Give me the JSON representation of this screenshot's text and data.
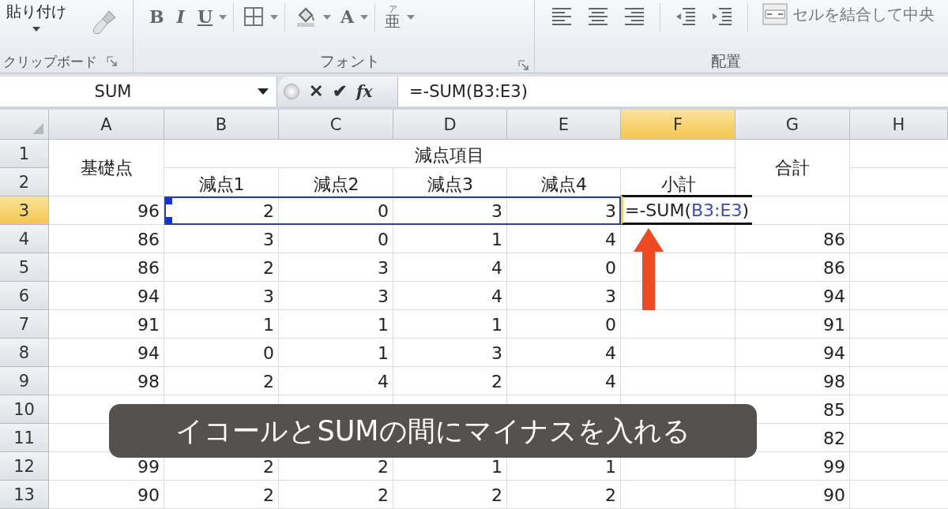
{
  "ribbon": {
    "clipboard": {
      "paste_label": "貼り付け",
      "label": "クリップボード"
    },
    "font": {
      "label": "フォント",
      "buttons": [
        {
          "kind": "bold",
          "text": "B"
        },
        {
          "kind": "italic",
          "text": "I"
        },
        {
          "kind": "underline",
          "text": "U"
        },
        {
          "kind": "borders"
        },
        {
          "kind": "fill"
        },
        {
          "kind": "font-color",
          "text": "A"
        },
        {
          "kind": "phonetic",
          "text": "亜",
          "ruby": "ア"
        }
      ]
    },
    "alignment": {
      "label": "配置",
      "merge_label": "セルを結合して中央"
    }
  },
  "formula_bar": {
    "name_box": "SUM",
    "cancel": "✕",
    "enter": "✔",
    "function": "fx",
    "formula": "=-SUM(B3:E3)"
  },
  "sheet": {
    "columns": [
      {
        "label": "A",
        "selected": false
      },
      {
        "label": "B",
        "selected": false
      },
      {
        "label": "C",
        "selected": false
      },
      {
        "label": "D",
        "selected": false
      },
      {
        "label": "E",
        "selected": false
      },
      {
        "label": "F",
        "selected": true
      },
      {
        "label": "G",
        "selected": false
      },
      {
        "label": "H",
        "selected": false
      }
    ],
    "titles": {
      "base": "基礎点",
      "group": "減点項目",
      "total": "合計"
    },
    "rows": [
      {
        "label": "1",
        "selected": false,
        "kind": "header"
      },
      {
        "label": "2",
        "selected": false,
        "kind": "header",
        "cells": {
          "B": "減点1",
          "C": "減点2",
          "D": "減点3",
          "E": "減点4",
          "F": "小計"
        }
      },
      {
        "label": "3",
        "selected": true,
        "kind": "data",
        "cells": {
          "A": "96",
          "B": "2",
          "C": "0",
          "D": "3",
          "E": "3",
          "F": {
            "parts": [
              {
                "text": "=-SUM(",
                "kind": "plain"
              },
              {
                "text": "B3:E3",
                "kind": "reference"
              },
              {
                "text": ")",
                "kind": "plain"
              }
            ]
          }
        }
      },
      {
        "label": "4",
        "selected": false,
        "kind": "data",
        "cells": {
          "A": "86",
          "B": "3",
          "C": "0",
          "D": "1",
          "E": "4",
          "G": "86"
        }
      },
      {
        "label": "5",
        "selected": false,
        "kind": "data",
        "cells": {
          "A": "86",
          "B": "2",
          "C": "3",
          "D": "4",
          "E": "0",
          "G": "86"
        }
      },
      {
        "label": "6",
        "selected": false,
        "kind": "data",
        "cells": {
          "A": "94",
          "B": "3",
          "C": "3",
          "D": "4",
          "E": "3",
          "G": "94"
        }
      },
      {
        "label": "7",
        "selected": false,
        "kind": "data",
        "cells": {
          "A": "91",
          "B": "1",
          "C": "1",
          "D": "1",
          "E": "0",
          "G": "91"
        }
      },
      {
        "label": "8",
        "selected": false,
        "kind": "data",
        "cells": {
          "A": "94",
          "B": "0",
          "C": "1",
          "D": "3",
          "E": "4",
          "G": "94"
        }
      },
      {
        "label": "9",
        "selected": false,
        "kind": "data",
        "cells": {
          "A": "98",
          "B": "2",
          "C": "4",
          "D": "2",
          "E": "4",
          "G": "98"
        }
      },
      {
        "label": "10",
        "selected": false,
        "kind": "data",
        "cells": {
          "G": "85"
        }
      },
      {
        "label": "11",
        "selected": false,
        "kind": "data",
        "cells": {
          "G": "82"
        }
      },
      {
        "label": "12",
        "selected": false,
        "kind": "data",
        "cells": {
          "A": "99",
          "B": "2",
          "C": "2",
          "D": "1",
          "E": "1",
          "G": "99"
        }
      },
      {
        "label": "13",
        "selected": false,
        "kind": "data",
        "cells": {
          "A": "90",
          "B": "2",
          "C": "2",
          "D": "2",
          "E": "2",
          "G": "90"
        }
      }
    ]
  },
  "caption": {
    "text": "イコールとSUMの間にマイナスを入れる"
  }
}
